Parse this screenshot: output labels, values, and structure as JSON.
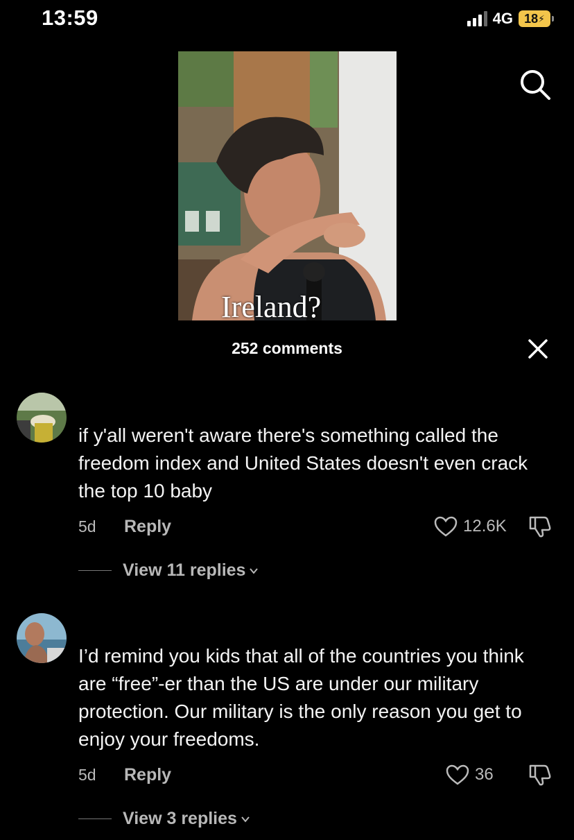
{
  "status_bar": {
    "time": "13:59",
    "network": "4G",
    "battery": "18"
  },
  "video": {
    "caption": "Ireland?"
  },
  "icons": {
    "search": "search-icon",
    "close": "close-icon",
    "like": "heart-outline-icon",
    "dislike": "thumbs-down-icon",
    "chevron": "chevron-down-icon"
  },
  "comments_panel": {
    "count_label": "252 comments",
    "comments": [
      {
        "text": "if y'all weren't aware there's something called the freedom index and United States doesn't even crack the top 10 baby",
        "age": "5d",
        "reply_label": "Reply",
        "likes": "12.6K",
        "view_replies": "View 11 replies"
      },
      {
        "text": "I’d remind you kids that all of the countries you think are “free”-er than the US are under our military protection. Our military is the only reason you get to enjoy your freedoms.",
        "age": "5d",
        "reply_label": "Reply",
        "likes": "36",
        "view_replies": "View 3 replies"
      }
    ]
  },
  "colors": {
    "background": "#000000",
    "battery": "#f3c54b",
    "secondary_text": "#b8b8b8"
  }
}
